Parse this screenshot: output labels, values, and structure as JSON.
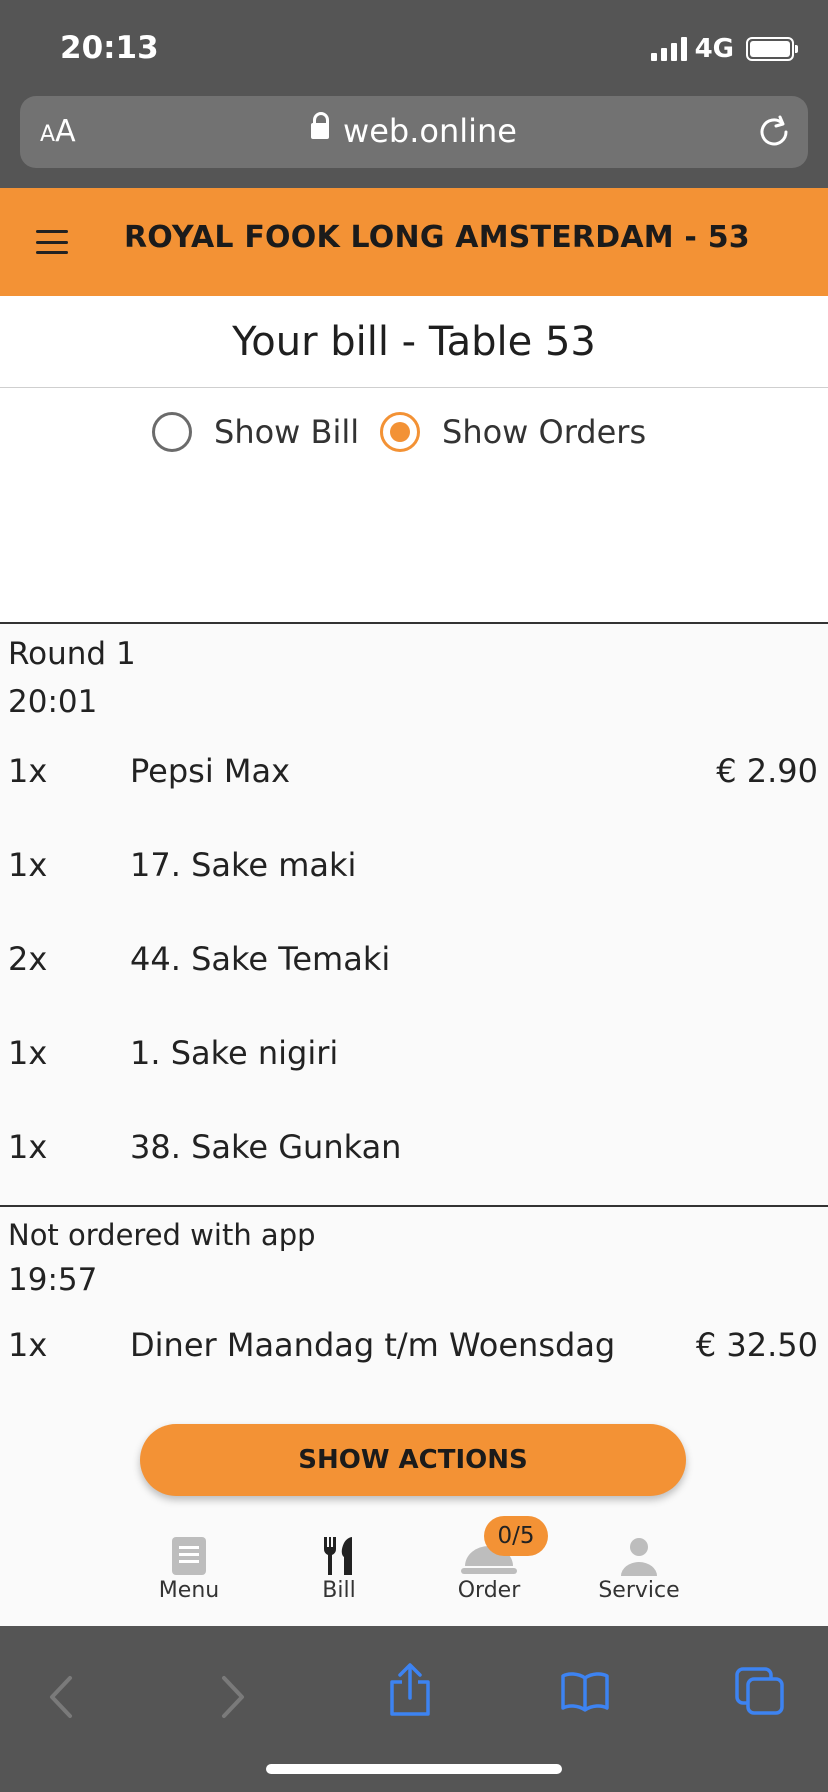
{
  "status_bar": {
    "time": "20:13",
    "network": "4G"
  },
  "browser": {
    "text_size_label": "AA",
    "url": "web.online"
  },
  "header": {
    "title": "ROYAL FOOK LONG AMSTERDAM - 53"
  },
  "page_title": "Your bill - Table 53",
  "view_toggle": {
    "options": [
      {
        "label": "Show Bill",
        "selected": false
      },
      {
        "label": "Show Orders",
        "selected": true
      }
    ]
  },
  "rounds": [
    {
      "label": "Round 1",
      "time": "20:01",
      "items": [
        {
          "qty": "1x",
          "name": "Pepsi Max",
          "price": "€ 2.90"
        },
        {
          "qty": "1x",
          "name": "17. Sake maki",
          "price": ""
        },
        {
          "qty": "2x",
          "name": "44. Sake Temaki",
          "price": ""
        },
        {
          "qty": "1x",
          "name": "1. Sake nigiri",
          "price": ""
        },
        {
          "qty": "1x",
          "name": "38. Sake Gunkan",
          "price": ""
        }
      ]
    },
    {
      "label": "Not ordered with app",
      "time": "19:57",
      "items": [
        {
          "qty": "1x",
          "name": "Diner Maandag t/m Woensdag",
          "price": "€ 32.50"
        }
      ]
    }
  ],
  "actions_button": "SHOW ACTIONS",
  "tabbar": {
    "items": [
      {
        "label": "Menu",
        "icon": "book-icon"
      },
      {
        "label": "Bill",
        "icon": "cutlery-icon"
      },
      {
        "label": "Order",
        "icon": "cloche-icon"
      },
      {
        "label": "Service",
        "icon": "person-icon"
      }
    ],
    "order_badge": "0/5"
  },
  "colors": {
    "accent": "#f39235",
    "chrome": "#555555",
    "ios_blue": "#3d83f2"
  }
}
